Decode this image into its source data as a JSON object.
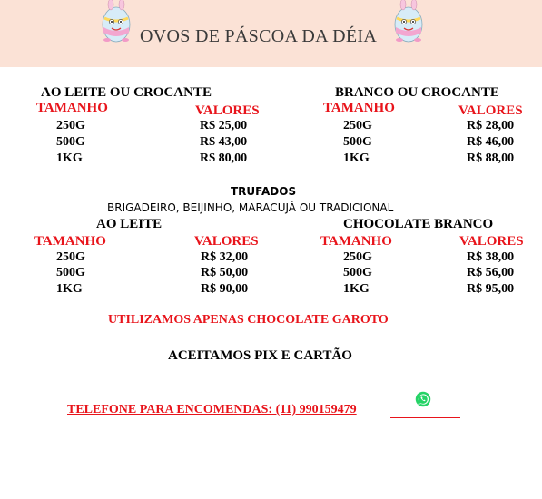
{
  "header": {
    "title": "OVOS DE PÁSCOA DA DÉIA"
  },
  "colors": {
    "header_bg": "#fbe2d6",
    "accent_red": "#e8141b"
  },
  "section1": {
    "left": {
      "heading": "AO LEITE OU CROCANTE",
      "col_size": "TAMANHO",
      "col_price": "VALORES",
      "rows": [
        {
          "size": "250G",
          "price": "R$ 25,00"
        },
        {
          "size": "500G",
          "price": "R$ 43,00"
        },
        {
          "size": "1KG",
          "price": "R$ 80,00"
        }
      ]
    },
    "right": {
      "heading": "BRANCO OU CROCANTE",
      "col_size": "TAMANHO",
      "col_price": "VALORES",
      "rows": [
        {
          "size": "250G",
          "price": "R$ 28,00"
        },
        {
          "size": "500G",
          "price": "R$ 46,00"
        },
        {
          "size": "1KG",
          "price": "R$ 88,00"
        }
      ]
    }
  },
  "section2": {
    "title": "TRUFADOS",
    "flavors": "BRIGADEIRO, BEIJINHO, MARACUJÁ OU TRADICIONAL",
    "left": {
      "heading": "AO LEITE",
      "col_size": "TAMANHO",
      "col_price": "VALORES",
      "rows": [
        {
          "size": "250G",
          "price": "R$ 32,00"
        },
        {
          "size": "500G",
          "price": "R$ 50,00"
        },
        {
          "size": "1KG",
          "price": "R$ 90,00"
        }
      ]
    },
    "right": {
      "heading": "CHOCOLATE BRANCO",
      "col_size": "TAMANHO",
      "col_price": "VALORES",
      "rows": [
        {
          "size": "250G",
          "price": "R$ 38,00"
        },
        {
          "size": "500G",
          "price": "R$ 56,00"
        },
        {
          "size": "1KG",
          "price": "R$ 95,00"
        }
      ]
    }
  },
  "notes": {
    "chocolate": "UTILIZAMOS APENAS CHOCOLATE GAROTO",
    "payment": "ACEITAMOS PIX E CARTÃO",
    "phone": "TELEFONE PARA ENCOMENDAS: (11) 990159479"
  },
  "icons": {
    "left_egg": "easter-egg-icon",
    "right_egg": "easter-egg-icon",
    "whatsapp": "whatsapp-icon"
  }
}
